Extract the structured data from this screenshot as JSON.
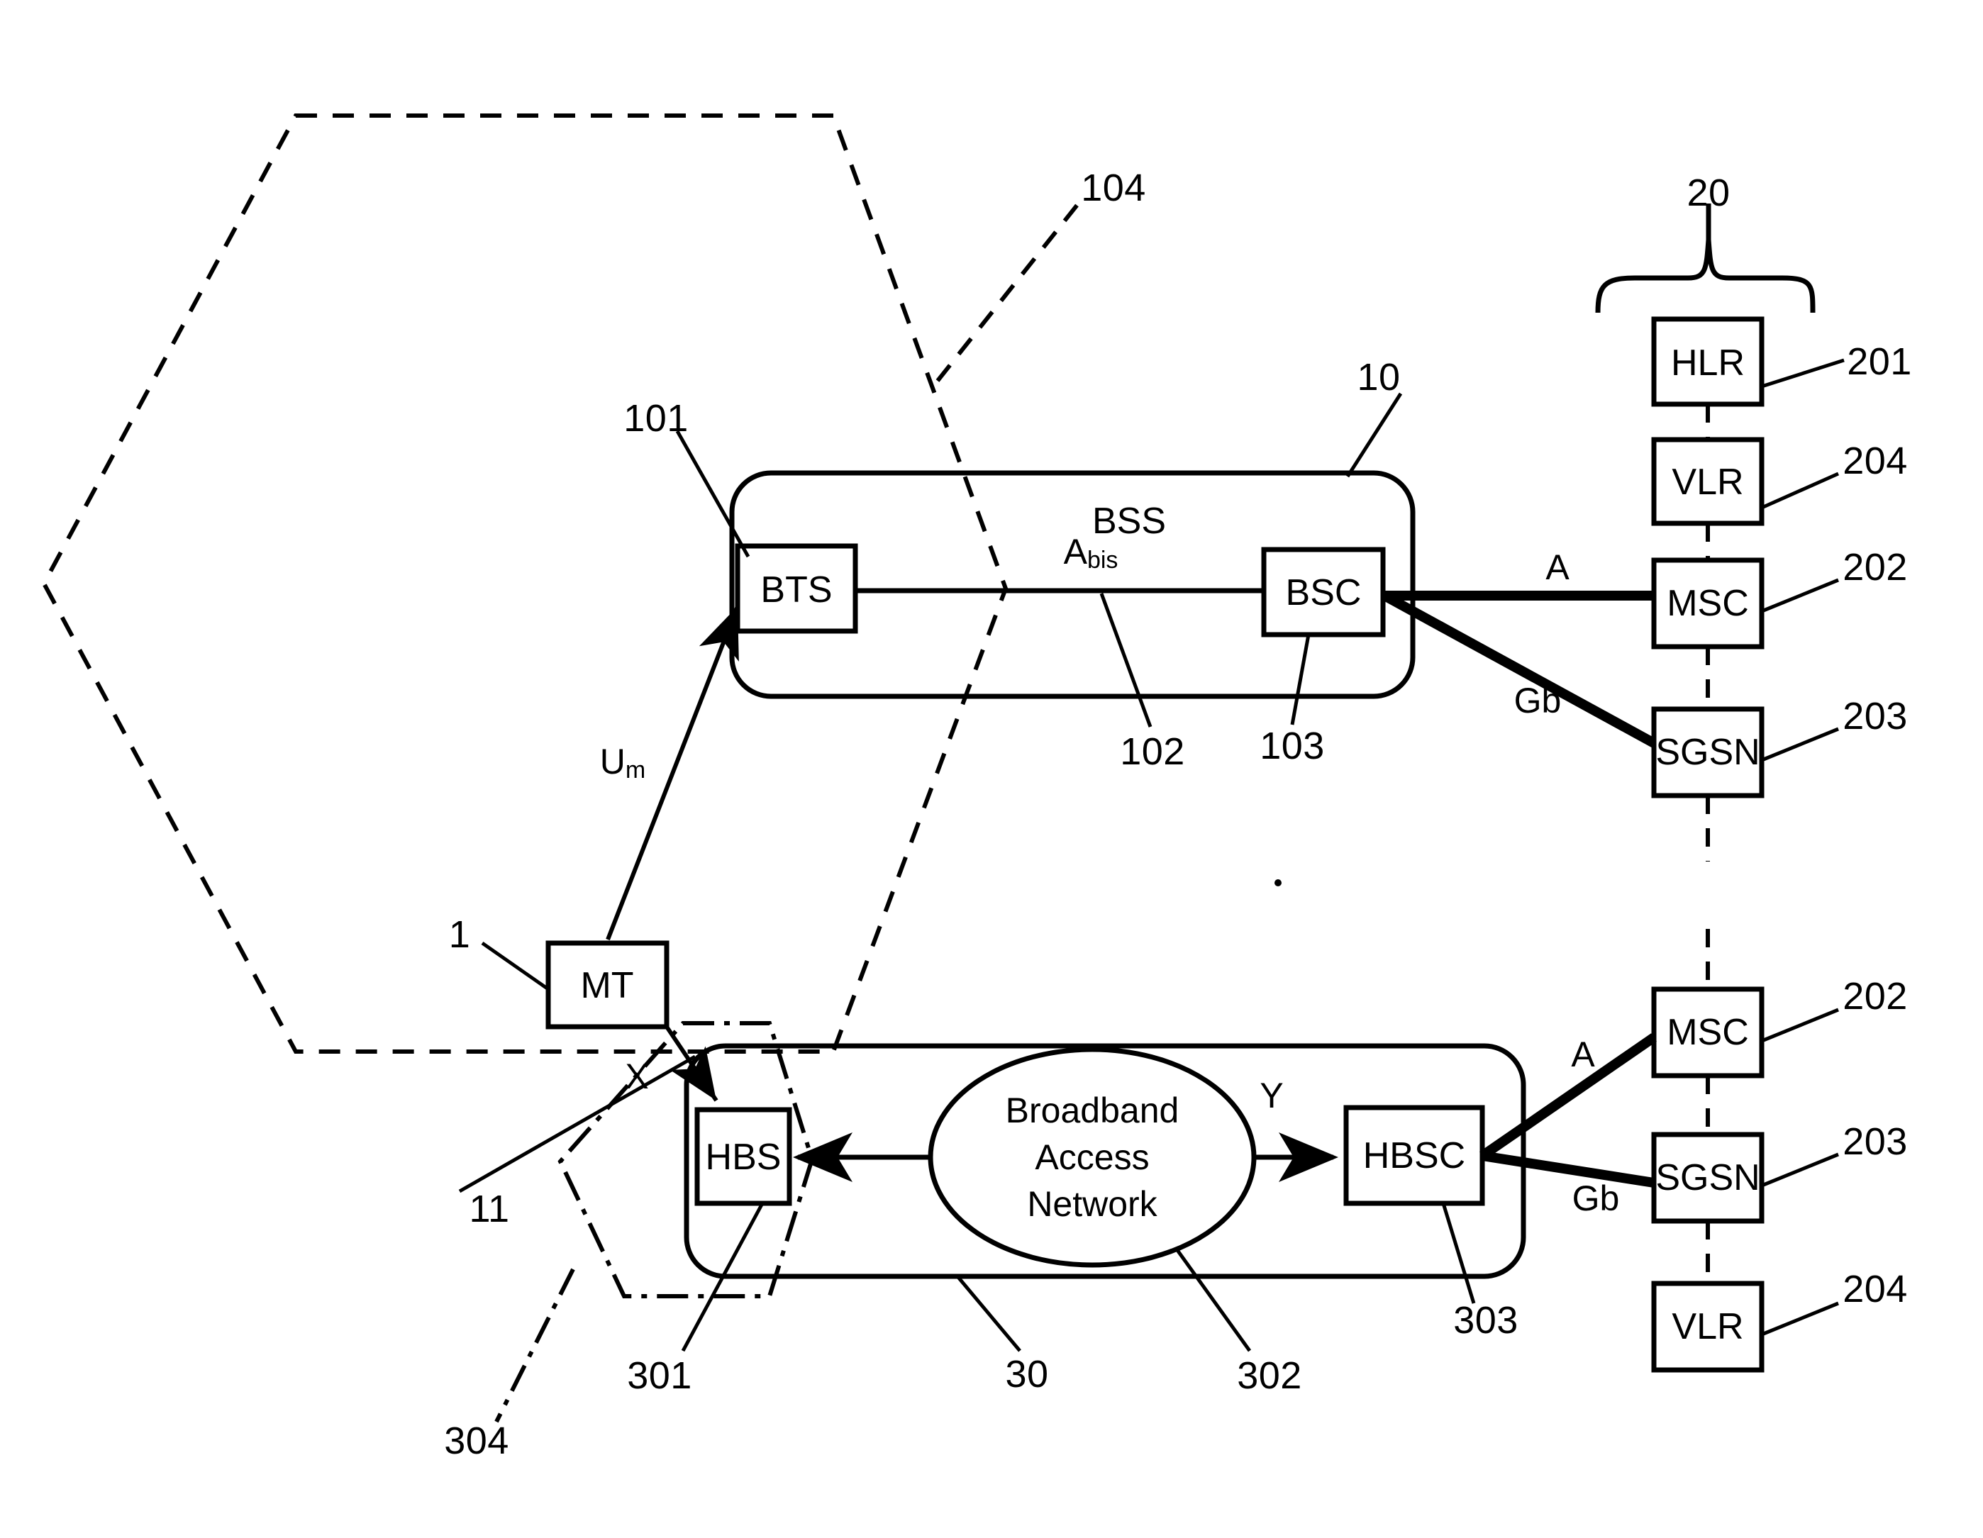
{
  "figure": {
    "title": "GSM BSS and Broadband Access Network architecture",
    "stroke_color": "#000000",
    "background_color": "#ffffff"
  },
  "blocks": {
    "bts": "BTS",
    "bsc": "BSC",
    "bss": "BSS",
    "mt": "MT",
    "hbs": "HBS",
    "hbsc": "HBSC",
    "broadband_cloud": "Broadband Access Network",
    "broadband_cloud_lines": [
      "Broadband",
      "Access",
      "Network"
    ],
    "hlr_top": "HLR",
    "vlr_top": "VLR",
    "msc_top": "MSC",
    "sgsn_top": "SGSN",
    "msc_bottom": "MSC",
    "sgsn_bottom": "SGSN",
    "vlr_bottom": "VLR"
  },
  "interfaces": {
    "um": "U",
    "um_sub": "m",
    "abis": "A",
    "abis_sub": "bis",
    "a_top": "A",
    "gb_top": "Gb",
    "a_bottom": "A",
    "gb_bottom": "Gb",
    "x": "X",
    "y": "Y"
  },
  "reference_numerals": {
    "n1": "1",
    "n10": "10",
    "n11": "11",
    "n20": "20",
    "n30": "30",
    "n101": "101",
    "n102": "102",
    "n103": "103",
    "n104": "104",
    "n201": "201",
    "n202_top": "202",
    "n203_top": "203",
    "n204_top": "204",
    "n202_bottom": "202",
    "n203_bottom": "203",
    "n204_bottom": "204",
    "n301": "301",
    "n302": "302",
    "n303": "303",
    "n304": "304"
  }
}
